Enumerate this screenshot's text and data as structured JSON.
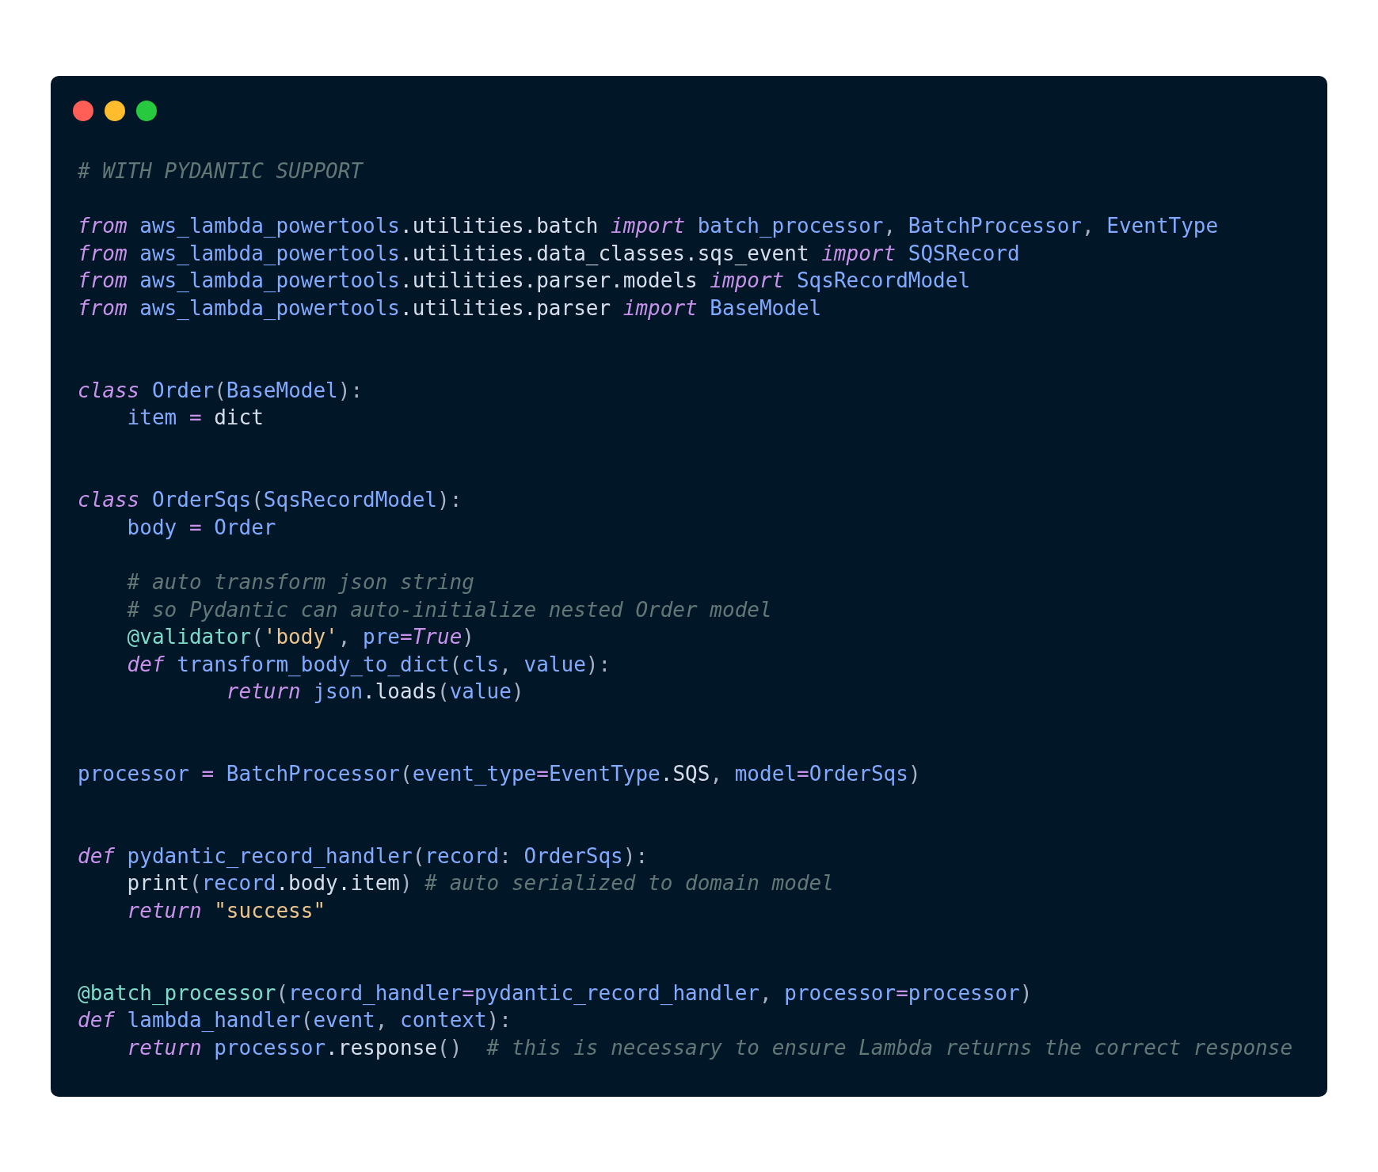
{
  "window": {
    "controls": [
      {
        "color": "#ff5f56"
      },
      {
        "color": "#ffbd2e"
      },
      {
        "color": "#27c93f"
      }
    ]
  },
  "code": {
    "lines": [
      {
        "kind": "code",
        "tokens": [
          {
            "kind": "comment",
            "text": "# WITH PYDANTIC SUPPORT"
          }
        ]
      },
      {
        "kind": "blank"
      },
      {
        "kind": "code",
        "tokens": [
          {
            "kind": "keyword",
            "text": "from"
          },
          {
            "kind": "name",
            "text": " aws_lambda_powertools"
          },
          {
            "kind": "plain",
            "text": ".utilities.batch "
          },
          {
            "kind": "keyword",
            "text": "import"
          },
          {
            "kind": "name",
            "text": " batch_processor"
          },
          {
            "kind": "punct",
            "text": ", "
          },
          {
            "kind": "name",
            "text": "BatchProcessor"
          },
          {
            "kind": "punct",
            "text": ", "
          },
          {
            "kind": "name",
            "text": "EventType"
          }
        ]
      },
      {
        "kind": "code",
        "tokens": [
          {
            "kind": "keyword",
            "text": "from"
          },
          {
            "kind": "name",
            "text": " aws_lambda_powertools"
          },
          {
            "kind": "plain",
            "text": ".utilities.data_classes.sqs_event "
          },
          {
            "kind": "keyword",
            "text": "import"
          },
          {
            "kind": "name",
            "text": " SQSRecord"
          }
        ]
      },
      {
        "kind": "code",
        "tokens": [
          {
            "kind": "keyword",
            "text": "from"
          },
          {
            "kind": "name",
            "text": " aws_lambda_powertools"
          },
          {
            "kind": "plain",
            "text": ".utilities.parser.models "
          },
          {
            "kind": "keyword",
            "text": "import"
          },
          {
            "kind": "name",
            "text": " SqsRecordModel"
          }
        ]
      },
      {
        "kind": "code",
        "tokens": [
          {
            "kind": "keyword",
            "text": "from"
          },
          {
            "kind": "name",
            "text": " aws_lambda_powertools"
          },
          {
            "kind": "plain",
            "text": ".utilities.parser "
          },
          {
            "kind": "keyword",
            "text": "import"
          },
          {
            "kind": "name",
            "text": " BaseModel"
          }
        ]
      },
      {
        "kind": "blank"
      },
      {
        "kind": "blank"
      },
      {
        "kind": "code",
        "tokens": [
          {
            "kind": "keyword",
            "text": "class"
          },
          {
            "kind": "name",
            "text": " Order"
          },
          {
            "kind": "punct",
            "text": "("
          },
          {
            "kind": "name",
            "text": "BaseModel"
          },
          {
            "kind": "punct",
            "text": "):"
          }
        ]
      },
      {
        "kind": "code",
        "tokens": [
          {
            "kind": "name",
            "text": "    item "
          },
          {
            "kind": "operator",
            "text": "="
          },
          {
            "kind": "plain",
            "text": " dict"
          }
        ]
      },
      {
        "kind": "blank"
      },
      {
        "kind": "blank"
      },
      {
        "kind": "code",
        "tokens": [
          {
            "kind": "keyword",
            "text": "class"
          },
          {
            "kind": "name",
            "text": " OrderSqs"
          },
          {
            "kind": "punct",
            "text": "("
          },
          {
            "kind": "name",
            "text": "SqsRecordModel"
          },
          {
            "kind": "punct",
            "text": "):"
          }
        ]
      },
      {
        "kind": "code",
        "tokens": [
          {
            "kind": "name",
            "text": "    body "
          },
          {
            "kind": "operator",
            "text": "="
          },
          {
            "kind": "name",
            "text": " Order"
          }
        ]
      },
      {
        "kind": "blank"
      },
      {
        "kind": "code",
        "tokens": [
          {
            "kind": "comment",
            "text": "    # auto transform json string"
          }
        ]
      },
      {
        "kind": "code",
        "tokens": [
          {
            "kind": "comment",
            "text": "    # so Pydantic can auto-initialize nested Order model"
          }
        ]
      },
      {
        "kind": "code",
        "tokens": [
          {
            "kind": "decorator",
            "text": "    @validator"
          },
          {
            "kind": "punct",
            "text": "("
          },
          {
            "kind": "string",
            "text": "'body'"
          },
          {
            "kind": "punct",
            "text": ", "
          },
          {
            "kind": "name",
            "text": "pre"
          },
          {
            "kind": "operator",
            "text": "="
          },
          {
            "kind": "keyword",
            "text": "True"
          },
          {
            "kind": "punct",
            "text": ")"
          }
        ]
      },
      {
        "kind": "code",
        "tokens": [
          {
            "kind": "keyword",
            "text": "    def"
          },
          {
            "kind": "name",
            "text": " transform_body_to_dict"
          },
          {
            "kind": "punct",
            "text": "("
          },
          {
            "kind": "name",
            "text": "cls"
          },
          {
            "kind": "punct",
            "text": ", "
          },
          {
            "kind": "name",
            "text": "value"
          },
          {
            "kind": "punct",
            "text": "):"
          }
        ]
      },
      {
        "kind": "code",
        "tokens": [
          {
            "kind": "keyword",
            "text": "            return"
          },
          {
            "kind": "name",
            "text": " json"
          },
          {
            "kind": "plain",
            "text": ".loads"
          },
          {
            "kind": "punct",
            "text": "("
          },
          {
            "kind": "name",
            "text": "value"
          },
          {
            "kind": "punct",
            "text": ")"
          }
        ]
      },
      {
        "kind": "blank"
      },
      {
        "kind": "blank"
      },
      {
        "kind": "code",
        "tokens": [
          {
            "kind": "name",
            "text": "processor "
          },
          {
            "kind": "operator",
            "text": "="
          },
          {
            "kind": "name",
            "text": " BatchProcessor"
          },
          {
            "kind": "punct",
            "text": "("
          },
          {
            "kind": "name",
            "text": "event_type"
          },
          {
            "kind": "operator",
            "text": "="
          },
          {
            "kind": "name",
            "text": "EventType"
          },
          {
            "kind": "plain",
            "text": ".SQS"
          },
          {
            "kind": "punct",
            "text": ", "
          },
          {
            "kind": "name",
            "text": "model"
          },
          {
            "kind": "operator",
            "text": "="
          },
          {
            "kind": "name",
            "text": "OrderSqs"
          },
          {
            "kind": "punct",
            "text": ")"
          }
        ]
      },
      {
        "kind": "blank"
      },
      {
        "kind": "blank"
      },
      {
        "kind": "code",
        "tokens": [
          {
            "kind": "keyword",
            "text": "def"
          },
          {
            "kind": "name",
            "text": " pydantic_record_handler"
          },
          {
            "kind": "punct",
            "text": "("
          },
          {
            "kind": "name",
            "text": "record"
          },
          {
            "kind": "punct",
            "text": ": "
          },
          {
            "kind": "name",
            "text": "OrderSqs"
          },
          {
            "kind": "punct",
            "text": "):"
          }
        ]
      },
      {
        "kind": "code",
        "tokens": [
          {
            "kind": "plain",
            "text": "    print"
          },
          {
            "kind": "punct",
            "text": "("
          },
          {
            "kind": "name",
            "text": "record"
          },
          {
            "kind": "plain",
            "text": ".body.item"
          },
          {
            "kind": "punct",
            "text": ") "
          },
          {
            "kind": "comment",
            "text": "# auto serialized to domain model"
          }
        ]
      },
      {
        "kind": "code",
        "tokens": [
          {
            "kind": "keyword",
            "text": "    return"
          },
          {
            "kind": "string",
            "text": " \"success\""
          }
        ]
      },
      {
        "kind": "blank"
      },
      {
        "kind": "blank"
      },
      {
        "kind": "code",
        "tokens": [
          {
            "kind": "decorator",
            "text": "@batch_processor"
          },
          {
            "kind": "punct",
            "text": "("
          },
          {
            "kind": "name",
            "text": "record_handler"
          },
          {
            "kind": "operator",
            "text": "="
          },
          {
            "kind": "name",
            "text": "pydantic_record_handler"
          },
          {
            "kind": "punct",
            "text": ", "
          },
          {
            "kind": "name",
            "text": "processor"
          },
          {
            "kind": "operator",
            "text": "="
          },
          {
            "kind": "name",
            "text": "processor"
          },
          {
            "kind": "punct",
            "text": ")"
          }
        ]
      },
      {
        "kind": "code",
        "tokens": [
          {
            "kind": "keyword",
            "text": "def"
          },
          {
            "kind": "name",
            "text": " lambda_handler"
          },
          {
            "kind": "punct",
            "text": "("
          },
          {
            "kind": "name",
            "text": "event"
          },
          {
            "kind": "punct",
            "text": ", "
          },
          {
            "kind": "name",
            "text": "context"
          },
          {
            "kind": "punct",
            "text": "):"
          }
        ]
      },
      {
        "kind": "code",
        "tokens": [
          {
            "kind": "keyword",
            "text": "    return"
          },
          {
            "kind": "name",
            "text": " processor"
          },
          {
            "kind": "plain",
            "text": ".response"
          },
          {
            "kind": "punct",
            "text": "()  "
          },
          {
            "kind": "comment",
            "text": "# this is necessary to ensure Lambda returns the correct response"
          }
        ]
      }
    ]
  }
}
